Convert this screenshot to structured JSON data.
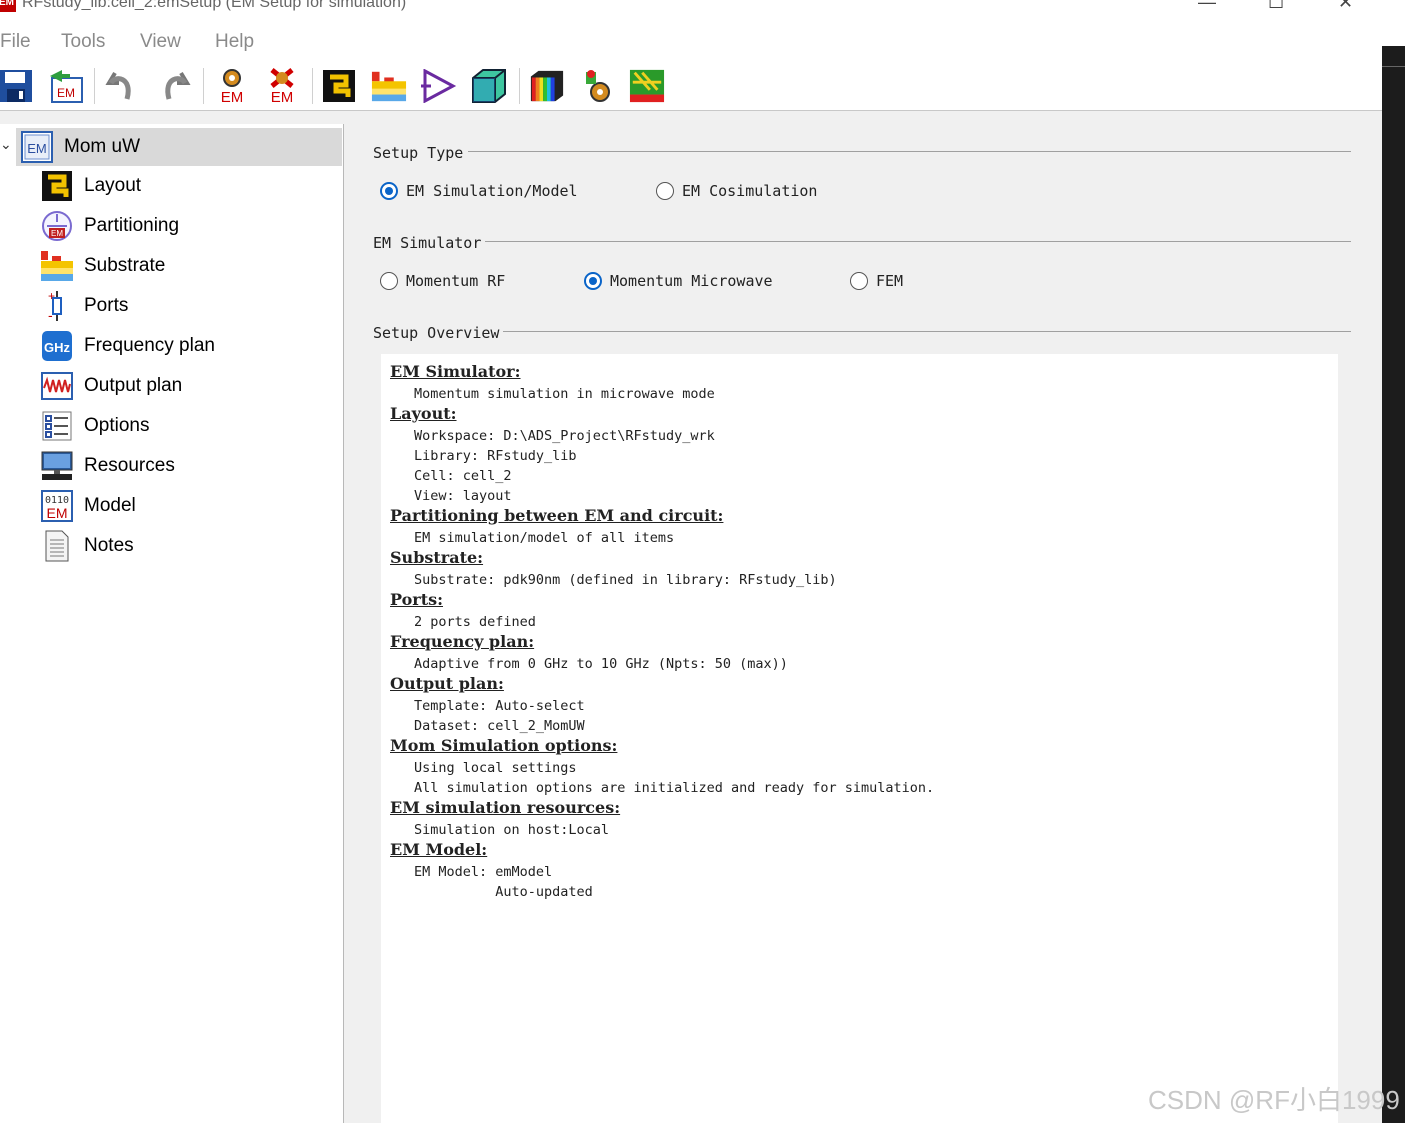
{
  "window": {
    "app_icon_text": "EM",
    "title": "RFstudy_lib:cell_2:emSetup (EM Setup for simulation)"
  },
  "menu": [
    "File",
    "Tools",
    "View",
    "Help"
  ],
  "toolbar_icons": [
    "save-icon",
    "em-export-icon",
    "undo-icon",
    "redo-icon",
    "em-simulate-icon",
    "em-stop-icon",
    "layout-icon",
    "substrate-icon",
    "ports-icon",
    "3d-view-icon",
    "results-icon",
    "component-icon",
    "mesh-icon"
  ],
  "toolbar": {
    "em1": "EM",
    "em2": "EM"
  },
  "tree": {
    "root": {
      "icon_text": "EM",
      "label": "Mom uW"
    },
    "items": [
      {
        "label": "Layout",
        "icon": "layout-icon"
      },
      {
        "label": "Partitioning",
        "icon": "partitioning-icon"
      },
      {
        "label": "Substrate",
        "icon": "substrate-icon"
      },
      {
        "label": "Ports",
        "icon": "ports-icon"
      },
      {
        "label": "Frequency plan",
        "icon": "frequency-icon"
      },
      {
        "label": "Output plan",
        "icon": "output-plan-icon"
      },
      {
        "label": "Options",
        "icon": "options-icon"
      },
      {
        "label": "Resources",
        "icon": "resources-icon"
      },
      {
        "label": "Model",
        "icon": "model-icon"
      },
      {
        "label": "Notes",
        "icon": "notes-icon"
      }
    ],
    "freq_icon_text": "GHz",
    "model_icon_text": "0110",
    "model_icon_text2": "EM"
  },
  "setup_type": {
    "label": "Setup Type",
    "options": [
      "EM Simulation/Model",
      "EM Cosimulation"
    ],
    "selected": "EM Simulation/Model"
  },
  "em_simulator": {
    "label": "EM Simulator",
    "options": [
      "Momentum RF",
      "Momentum Microwave",
      "FEM"
    ],
    "selected": "Momentum Microwave"
  },
  "overview": {
    "label": "Setup Overview",
    "sections": [
      {
        "heading": "EM Simulator:",
        "lines": [
          "Momentum simulation in microwave mode"
        ]
      },
      {
        "heading": "Layout:",
        "lines": [
          "Workspace: D:\\ADS_Project\\RFstudy_wrk",
          "Library: RFstudy_lib",
          "Cell: cell_2",
          "View: layout"
        ]
      },
      {
        "heading": "Partitioning between EM and circuit:",
        "lines": [
          "EM simulation/model of all items"
        ]
      },
      {
        "heading": "Substrate:",
        "lines": [
          "Substrate: pdk90nm (defined in library: RFstudy_lib)"
        ]
      },
      {
        "heading": "Ports:",
        "lines": [
          "2 ports defined"
        ]
      },
      {
        "heading": "Frequency plan:",
        "lines": [
          "Adaptive from 0 GHz to 10 GHz (Npts: 50 (max))"
        ]
      },
      {
        "heading": "Output plan:",
        "lines": [
          "Template: Auto-select",
          "Dataset: cell_2_MomUW"
        ]
      },
      {
        "heading": "Mom Simulation options:",
        "lines": [
          "Using local settings",
          "All simulation options are initialized and ready for simulation."
        ]
      },
      {
        "heading": "EM simulation resources:",
        "lines": [
          "Simulation on host:Local"
        ]
      },
      {
        "heading": "EM Model:",
        "lines": [
          "EM Model: emModel",
          "          Auto-updated"
        ]
      }
    ]
  },
  "watermark": "CSDN @RF小白1999"
}
